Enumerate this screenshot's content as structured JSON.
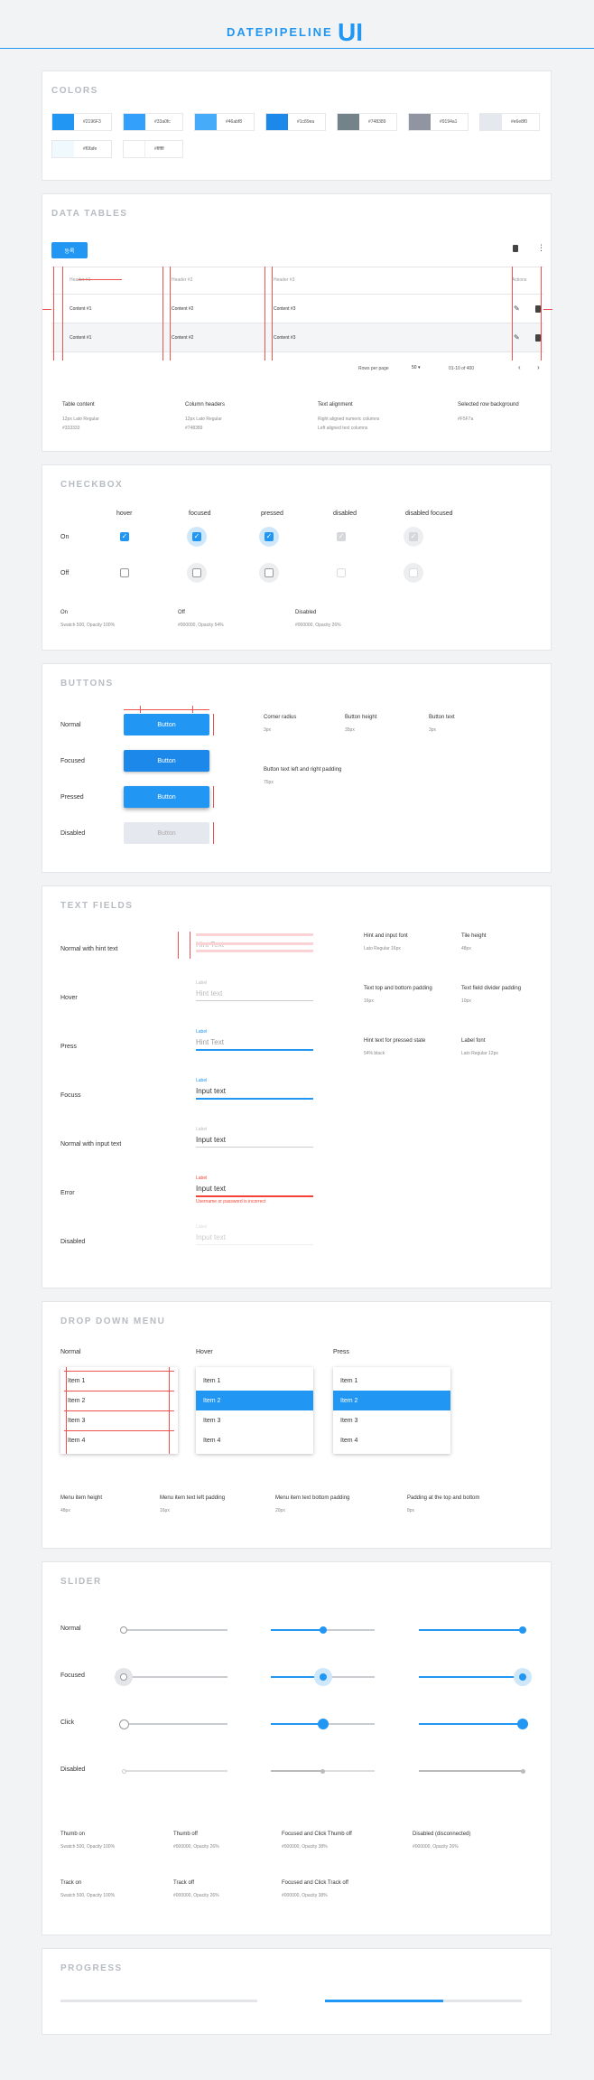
{
  "header": {
    "title": "DATEPIPELINE",
    "ui": "UI"
  },
  "colors": {
    "title": "COLORS",
    "swatches": [
      {
        "hex": "#2196F3"
      },
      {
        "hex": "#33a0fc"
      },
      {
        "hex": "#46abf8"
      },
      {
        "hex": "#1c89ea"
      },
      {
        "hex": "#748389"
      },
      {
        "hex": "#9194a1"
      },
      {
        "hex": "#e6e8f0"
      },
      {
        "hex": "#f0fafe"
      },
      {
        "hex": "#ffffff"
      }
    ]
  },
  "data_tables": {
    "title": "DATA TABLES",
    "button_label": "등록",
    "headers": [
      "Header #1",
      "Header #2",
      "Header #3",
      "Actions"
    ],
    "rows": [
      [
        "Content #1",
        "Content #2",
        "Content #3"
      ],
      [
        "Content #1",
        "Content #2",
        "Content #3"
      ]
    ],
    "rows_per_page_label": "Rows per page",
    "rows_per_page_value": "50",
    "range": "01-10 of 400",
    "specs": [
      {
        "h": "Table content",
        "v1": "12px Lato Regular",
        "v2": "#333333"
      },
      {
        "h": "Column headers",
        "v1": "12px Lato Regular",
        "v2": "#748389"
      },
      {
        "h": "Text alignment",
        "v1": "Right aligned numeric columns",
        "v2": "Left aligned text columns"
      },
      {
        "h": "Selected row background",
        "v1": "#F5F7a",
        "v2": ""
      }
    ]
  },
  "checkbox": {
    "title": "CHECKBOX",
    "columns": [
      "hover",
      "focused",
      "pressed",
      "disabled",
      "disabled focused"
    ],
    "rows": [
      "On",
      "Off"
    ],
    "specs": [
      {
        "h": "On",
        "v": "Swatch 500, Opacity 100%"
      },
      {
        "h": "Off",
        "v": "#000000, Opacity 54%"
      },
      {
        "h": "Disabled",
        "v": "#000000, Opacity 26%"
      }
    ]
  },
  "buttons": {
    "title": "BUTTONS",
    "states": [
      "Normal",
      "Focused",
      "Pressed",
      "Disabled"
    ],
    "button_label": "Button",
    "specs": [
      {
        "h": "Corner radius",
        "v": "3px"
      },
      {
        "h": "Button height",
        "v": "35px"
      },
      {
        "h": "Button text",
        "v": "3px"
      },
      {
        "h": "Button text left and right padding",
        "v": "75px"
      }
    ]
  },
  "text_fields": {
    "title": "TEXT FIELDS",
    "rows": [
      {
        "state": "Normal with hint text",
        "label": "",
        "text": "Hint Text"
      },
      {
        "state": "Hover",
        "label": "Label",
        "text": "Hint text"
      },
      {
        "state": "Press",
        "label": "Label",
        "text": "Hint Text"
      },
      {
        "state": "Focuss",
        "label": "Label",
        "text": "Input text"
      },
      {
        "state": "Normal with input text",
        "label": "Label",
        "text": "Input text"
      },
      {
        "state": "Error",
        "label": "Label",
        "text": "Input text",
        "error": "Username or password is incorrect"
      },
      {
        "state": "Disabled",
        "label": "Label",
        "text": "Input text"
      }
    ],
    "specs": [
      {
        "h": "Hint and input font",
        "v": "Lato Regular 16px"
      },
      {
        "h": "Tile height",
        "v": "48px"
      },
      {
        "h": "Text top and bottom padding",
        "v": "16px"
      },
      {
        "h": "Text field divider padding",
        "v": "10px"
      },
      {
        "h": "Hint text for pressed state",
        "v": "54% black"
      },
      {
        "h": "Label font",
        "v": "Lato Regular 12px"
      }
    ]
  },
  "dropdown": {
    "title": "DROP DOWN MENU",
    "columns": [
      "Normal",
      "Hover",
      "Press"
    ],
    "items": [
      "Item 1",
      "Item 2",
      "Item 3",
      "Item 4"
    ],
    "specs": [
      {
        "h": "Menu item height",
        "v": "48px"
      },
      {
        "h": "Menu item text left padding",
        "v": "16px"
      },
      {
        "h": "Menu item text bottom padding",
        "v": "20px"
      },
      {
        "h": "Padding at the top and bottom",
        "v": "8px"
      }
    ]
  },
  "slider": {
    "title": "SLIDER",
    "rows": [
      "Normal",
      "Focused",
      "Click",
      "Disabled"
    ],
    "levels": [
      0,
      0.5,
      1
    ],
    "specs": [
      {
        "h": "Thumb on",
        "v": "Swatch 500, Opacity 100%"
      },
      {
        "h": "Thumb off",
        "v": "#000000, Opacity 26%"
      },
      {
        "h": "Focused and Click Thumb off",
        "v": "#000000, Opacity 38%"
      },
      {
        "h": "Disabled (disconnected)",
        "v": "#000000, Opacity 26%"
      },
      {
        "h": "Track on",
        "v": "Swatch 500, Opacity 100%"
      },
      {
        "h": "Track off",
        "v": "#000000, Opacity 26%"
      },
      {
        "h": "Focused and Click Track off",
        "v": "#000000, Opacity 38%"
      }
    ]
  },
  "progress": {
    "title": "PROGRESS",
    "values": [
      0,
      0.6
    ]
  }
}
